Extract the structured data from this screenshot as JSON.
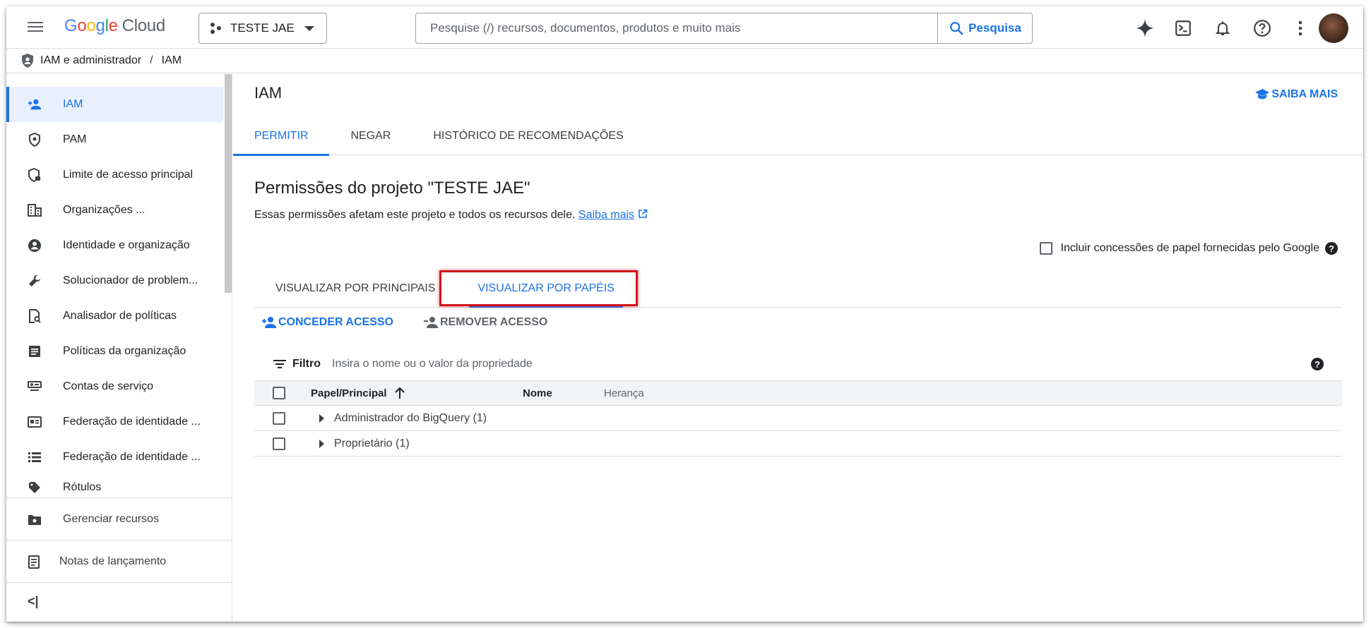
{
  "topbar": {
    "logo_google": "Google",
    "logo_cloud": "Cloud",
    "project_name": "TESTE JAE",
    "search_placeholder": "Pesquise (/) recursos, documentos, produtos e muito mais",
    "search_button": "Pesquisa",
    "icons": [
      "gemini-sparkle-icon",
      "cloud-shell-icon",
      "notifications-icon",
      "help-icon",
      "more-vert-icon",
      "avatar"
    ]
  },
  "breadcrumb": {
    "section": "IAM e administrador",
    "separator": "/",
    "page": "IAM"
  },
  "sidebar": {
    "items": [
      {
        "label": "IAM",
        "icon": "person-add-icon",
        "active": true
      },
      {
        "label": "PAM",
        "icon": "shield-icon"
      },
      {
        "label": "Limite de acesso principal",
        "icon": "shield-lock-icon"
      },
      {
        "label": "Organizações ...",
        "icon": "building-icon"
      },
      {
        "label": "Identidade e organização",
        "icon": "account-circle-icon"
      },
      {
        "label": "Solucionador de problem...",
        "icon": "wrench-icon"
      },
      {
        "label": "Analisador de políticas",
        "icon": "policy-analyzer-icon"
      },
      {
        "label": "Políticas da organização",
        "icon": "document-list-icon"
      },
      {
        "label": "Contas de serviço",
        "icon": "service-account-icon"
      },
      {
        "label": "Federação de identidade ...",
        "icon": "id-card-icon"
      },
      {
        "label": "Federação de identidade ...",
        "icon": "list-icon"
      },
      {
        "label": "Rótulos",
        "icon": "label-icon"
      }
    ],
    "bottom_items": [
      {
        "label": "Gerenciar recursos",
        "icon": "folder-settings-icon"
      },
      {
        "label": "Notas de lançamento",
        "icon": "release-notes-icon"
      }
    ],
    "collapse_label": "<|"
  },
  "main": {
    "title": "IAM",
    "learn_more": "SAIBA MAIS",
    "tabs": [
      {
        "label": "PERMITIR",
        "active": true
      },
      {
        "label": "NEGAR"
      },
      {
        "label": "HISTÓRICO DE RECOMENDAÇÕES"
      }
    ],
    "section_title": "Permissões do projeto \"TESTE JAE\"",
    "section_desc": "Essas permissões afetam este projeto e todos os recursos dele.",
    "section_link": "Saiba mais",
    "include_google_label": "Incluir concessões de papel fornecidas pelo Google",
    "view_tabs": [
      {
        "label": "VISUALIZAR POR PRINCIPAIS"
      },
      {
        "label": "VISUALIZAR POR PAPÉIS",
        "active": true
      }
    ],
    "actions": {
      "grant": "CONCEDER ACESSO",
      "remove": "REMOVER ACESSO"
    },
    "filter": {
      "label": "Filtro",
      "placeholder": "Insira o nome ou o valor da propriedade"
    },
    "table": {
      "headers": [
        "Papel/Principal",
        "Nome",
        "Herança"
      ],
      "rows": [
        {
          "role": "Administrador do BigQuery (1)"
        },
        {
          "role": "Proprietário (1)"
        }
      ]
    }
  },
  "colors": {
    "accent": "#1a73e8",
    "highlight": "#d2131a",
    "active_bg": "#e8f0fe"
  }
}
